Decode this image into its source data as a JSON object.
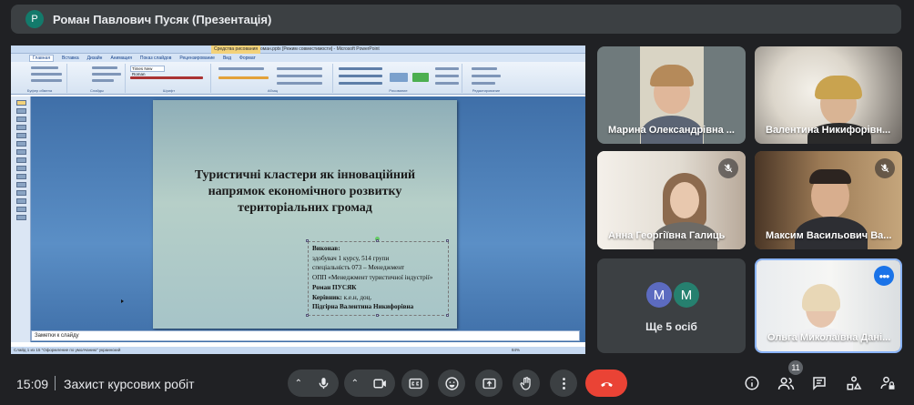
{
  "presenter": {
    "avatar_letter": "Р",
    "title": "Роман Павлович Пусяк (Презентація)"
  },
  "powerpoint": {
    "window_title": "Презентація Пусяк Роман.pptx [Режим совместимости] - Microsoft PowerPoint",
    "context_tab": "Средства рисования",
    "tabs": [
      "Главная",
      "Вставка",
      "Дизайн",
      "Анимация",
      "Показ слайдов",
      "Рецензирование",
      "Вид",
      "Формат"
    ],
    "groups": [
      "Буфер обмена",
      "Слайды",
      "Шрифт",
      "Абзац",
      "Рисование",
      "Редактирование"
    ],
    "font_name": "Times New Roman",
    "notes_placeholder": "Заметки к слайду",
    "status_text": "Слайд 1 из 15   \"Оформление по умолчанию\"   украинский",
    "zoom": "84%"
  },
  "slide": {
    "title": "Туристичні кластери як інноваційний напрямок економічного розвитку територіальних громад",
    "lines": [
      {
        "text": "Виконав:",
        "bold": true
      },
      {
        "text": "здобувач 1 курсу,  514  групи",
        "bold": false
      },
      {
        "text": "спеціальність 073 – Менеджмент",
        "bold": false
      },
      {
        "text": "ОПП «Менеджмент туристичної індустрії»",
        "bold": false
      },
      {
        "text": "Роман ПУСЯК",
        "bold": true
      },
      {
        "text": "Керівник:",
        "bold": true,
        "rest": " к.е.н, доц."
      },
      {
        "text": "Підгірна Валентина Никифорівна",
        "bold": true
      }
    ]
  },
  "participants": [
    {
      "name": "Марина Олександрівна ...",
      "muted": false
    },
    {
      "name": "Валентина Никифорівн...",
      "muted": false
    },
    {
      "name": "Анна Георгіївна Галиць",
      "muted": true
    },
    {
      "name": "Максим Васильович Ва...",
      "muted": true
    },
    {
      "name": "Ольга Миколаївна Дані...",
      "muted": false
    }
  ],
  "others": {
    "avatars": [
      "M",
      "M"
    ],
    "label": "Ще 5 осіб",
    "colors": [
      "#5c6bc0",
      "#26806f"
    ]
  },
  "bottom": {
    "time": "15:09",
    "meeting_name": "Захист курсових робіт",
    "people_count": "11"
  },
  "colors": {
    "hangup": "#ea4335",
    "accent": "#1a73e8",
    "bar": "#3c4043"
  }
}
